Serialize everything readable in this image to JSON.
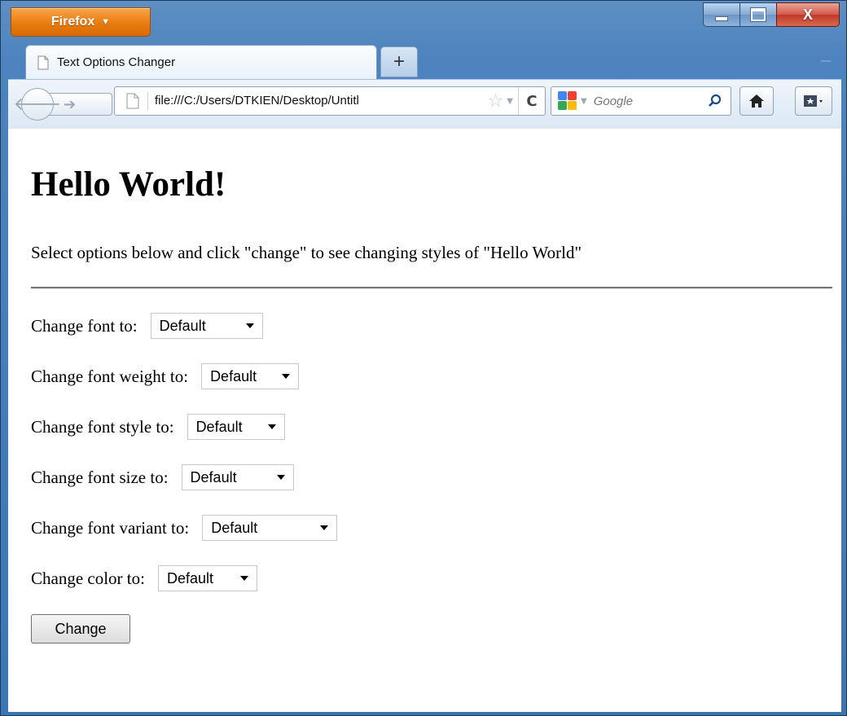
{
  "browser": {
    "menu_label": "Firefox",
    "tab_title": "Text Options Changer",
    "new_tab_symbol": "+",
    "url": "file:///C:/Users/DTKIEN/Desktop/Untitl",
    "search_engine_placeholder": "Google",
    "caption": {
      "close_symbol": "X"
    }
  },
  "page": {
    "heading": "Hello World!",
    "description": "Select options below and click \"change\" to see changing styles of \"Hello World\"",
    "options": [
      {
        "label": "Change font to:",
        "value": "Default"
      },
      {
        "label": "Change font weight to:",
        "value": "Default"
      },
      {
        "label": "Change font style to:",
        "value": "Default"
      },
      {
        "label": "Change font size to:",
        "value": "Default"
      },
      {
        "label": "Change font variant to:",
        "value": "Default"
      },
      {
        "label": "Change color to:",
        "value": "Default"
      }
    ],
    "change_button": "Change"
  }
}
